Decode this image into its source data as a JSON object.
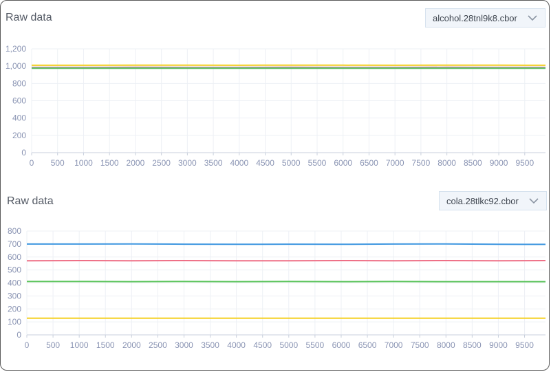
{
  "panels": [
    {
      "title": "Raw data",
      "file_select": "alcohol.28tnl9k8.cbor",
      "chevron_icon": "chevron-down-icon"
    },
    {
      "title": "Raw data",
      "file_select": "cola.28tlkc92.cbor",
      "chevron_icon": "chevron-down-icon"
    }
  ],
  "chart_data": [
    {
      "type": "line",
      "x_ticks": [
        "0",
        "500",
        "1000",
        "1500",
        "2000",
        "2500",
        "3000",
        "3500",
        "4000",
        "4500",
        "5000",
        "5500",
        "6000",
        "6500",
        "7000",
        "7500",
        "8000",
        "8500",
        "9000",
        "9500"
      ],
      "y_ticks": [
        "0",
        "200",
        "400",
        "600",
        "800",
        "1,000",
        "1,200"
      ],
      "xlim": [
        0,
        9900
      ],
      "ylim": [
        0,
        1200
      ],
      "grid": true,
      "x": [
        0,
        1000,
        2000,
        3000,
        4000,
        5000,
        6000,
        7000,
        8000,
        9000,
        9900
      ],
      "series": [
        {
          "color": "#f5d023",
          "values": [
            1010,
            1010,
            1012,
            1011,
            1010,
            1012,
            1011,
            1010,
            1012,
            1011,
            1010
          ]
        },
        {
          "color": "#e86f84",
          "values": [
            985,
            985,
            986,
            985,
            985,
            986,
            985,
            985,
            986,
            985,
            985
          ]
        },
        {
          "color": "#9aa0b0",
          "values": [
            980,
            980,
            981,
            980,
            980,
            981,
            980,
            980,
            981,
            980,
            980
          ]
        },
        {
          "color": "#5cbf62",
          "values": [
            975,
            975,
            976,
            975,
            975,
            976,
            975,
            975,
            976,
            975,
            975
          ]
        }
      ]
    },
    {
      "type": "line",
      "x_ticks": [
        "0",
        "500",
        "1000",
        "1500",
        "2000",
        "2500",
        "3000",
        "3500",
        "4000",
        "4500",
        "5000",
        "5500",
        "6000",
        "6500",
        "7000",
        "7500",
        "8000",
        "8500",
        "9000",
        "9500"
      ],
      "y_ticks": [
        "0",
        "100",
        "200",
        "300",
        "400",
        "500",
        "600",
        "700",
        "800"
      ],
      "xlim": [
        0,
        9900
      ],
      "ylim": [
        0,
        800
      ],
      "grid": true,
      "x": [
        0,
        1000,
        2000,
        3000,
        4000,
        5000,
        6000,
        7000,
        8000,
        9000,
        9900
      ],
      "series": [
        {
          "color": "#3f97e0",
          "values": [
            700,
            700,
            701,
            699,
            698,
            699,
            698,
            700,
            701,
            698,
            697
          ]
        },
        {
          "color": "#ee6f86",
          "values": [
            571,
            572,
            571,
            572,
            571,
            571,
            572,
            571,
            572,
            571,
            572
          ]
        },
        {
          "color": "#5cc45c",
          "values": [
            411,
            411,
            410,
            411,
            410,
            411,
            410,
            411,
            410,
            410,
            410
          ]
        },
        {
          "color": "#f5d023",
          "values": [
            129,
            128,
            128,
            129,
            128,
            128,
            129,
            128,
            129,
            128,
            128
          ]
        }
      ]
    }
  ]
}
